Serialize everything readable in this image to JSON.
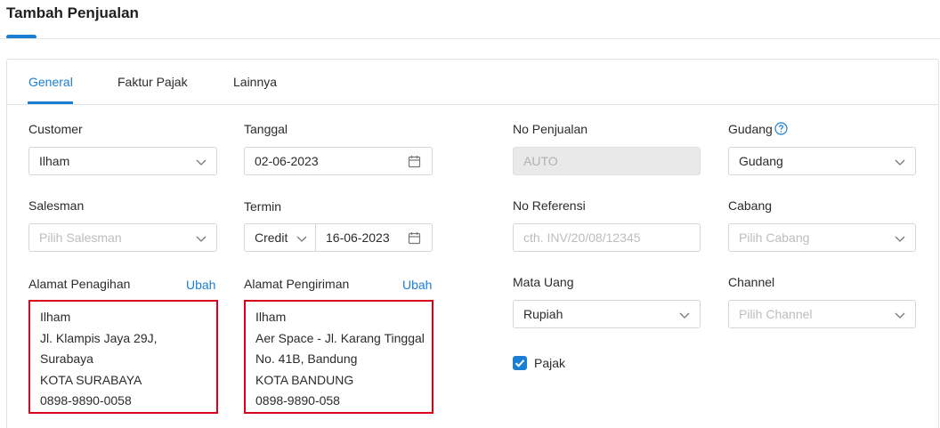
{
  "page": {
    "title": "Tambah Penjualan"
  },
  "tabs": [
    {
      "label": "General",
      "active": true
    },
    {
      "label": "Faktur Pajak",
      "active": false
    },
    {
      "label": "Lainnya",
      "active": false
    }
  ],
  "form": {
    "customer": {
      "label": "Customer",
      "value": "Ilham"
    },
    "tanggal": {
      "label": "Tanggal",
      "value": "02-06-2023"
    },
    "no_penjualan": {
      "label": "No Penjualan",
      "value": "AUTO"
    },
    "gudang": {
      "label": "Gudang",
      "value": "Gudang"
    },
    "salesman": {
      "label": "Salesman",
      "placeholder": "Pilih Salesman"
    },
    "termin": {
      "label": "Termin",
      "value": "Credit",
      "date": "16-06-2023"
    },
    "no_referensi": {
      "label": "No Referensi",
      "placeholder": "cth. INV/20/08/12345"
    },
    "cabang": {
      "label": "Cabang",
      "placeholder": "Pilih Cabang"
    },
    "mata_uang": {
      "label": "Mata Uang",
      "value": "Rupiah"
    },
    "channel": {
      "label": "Channel",
      "placeholder": "Pilih Channel"
    },
    "pajak": {
      "label": "Pajak",
      "checked": true
    }
  },
  "alamat_penagihan": {
    "label": "Alamat Penagihan",
    "edit_label": "Ubah",
    "lines": [
      "Ilham",
      "Jl. Klampis Jaya 29J,",
      "Surabaya",
      "KOTA SURABAYA",
      "0898-9890-0058"
    ]
  },
  "alamat_pengiriman": {
    "label": "Alamat Pengiriman",
    "edit_label": "Ubah",
    "lines": [
      "Ilham",
      "Aer Space - Jl. Karang Tinggal",
      "No. 41B, Bandung",
      "KOTA BANDUNG",
      "0898-9890-058"
    ]
  },
  "colors": {
    "accent": "#1a7fd4",
    "highlight_border": "#d9001b"
  }
}
